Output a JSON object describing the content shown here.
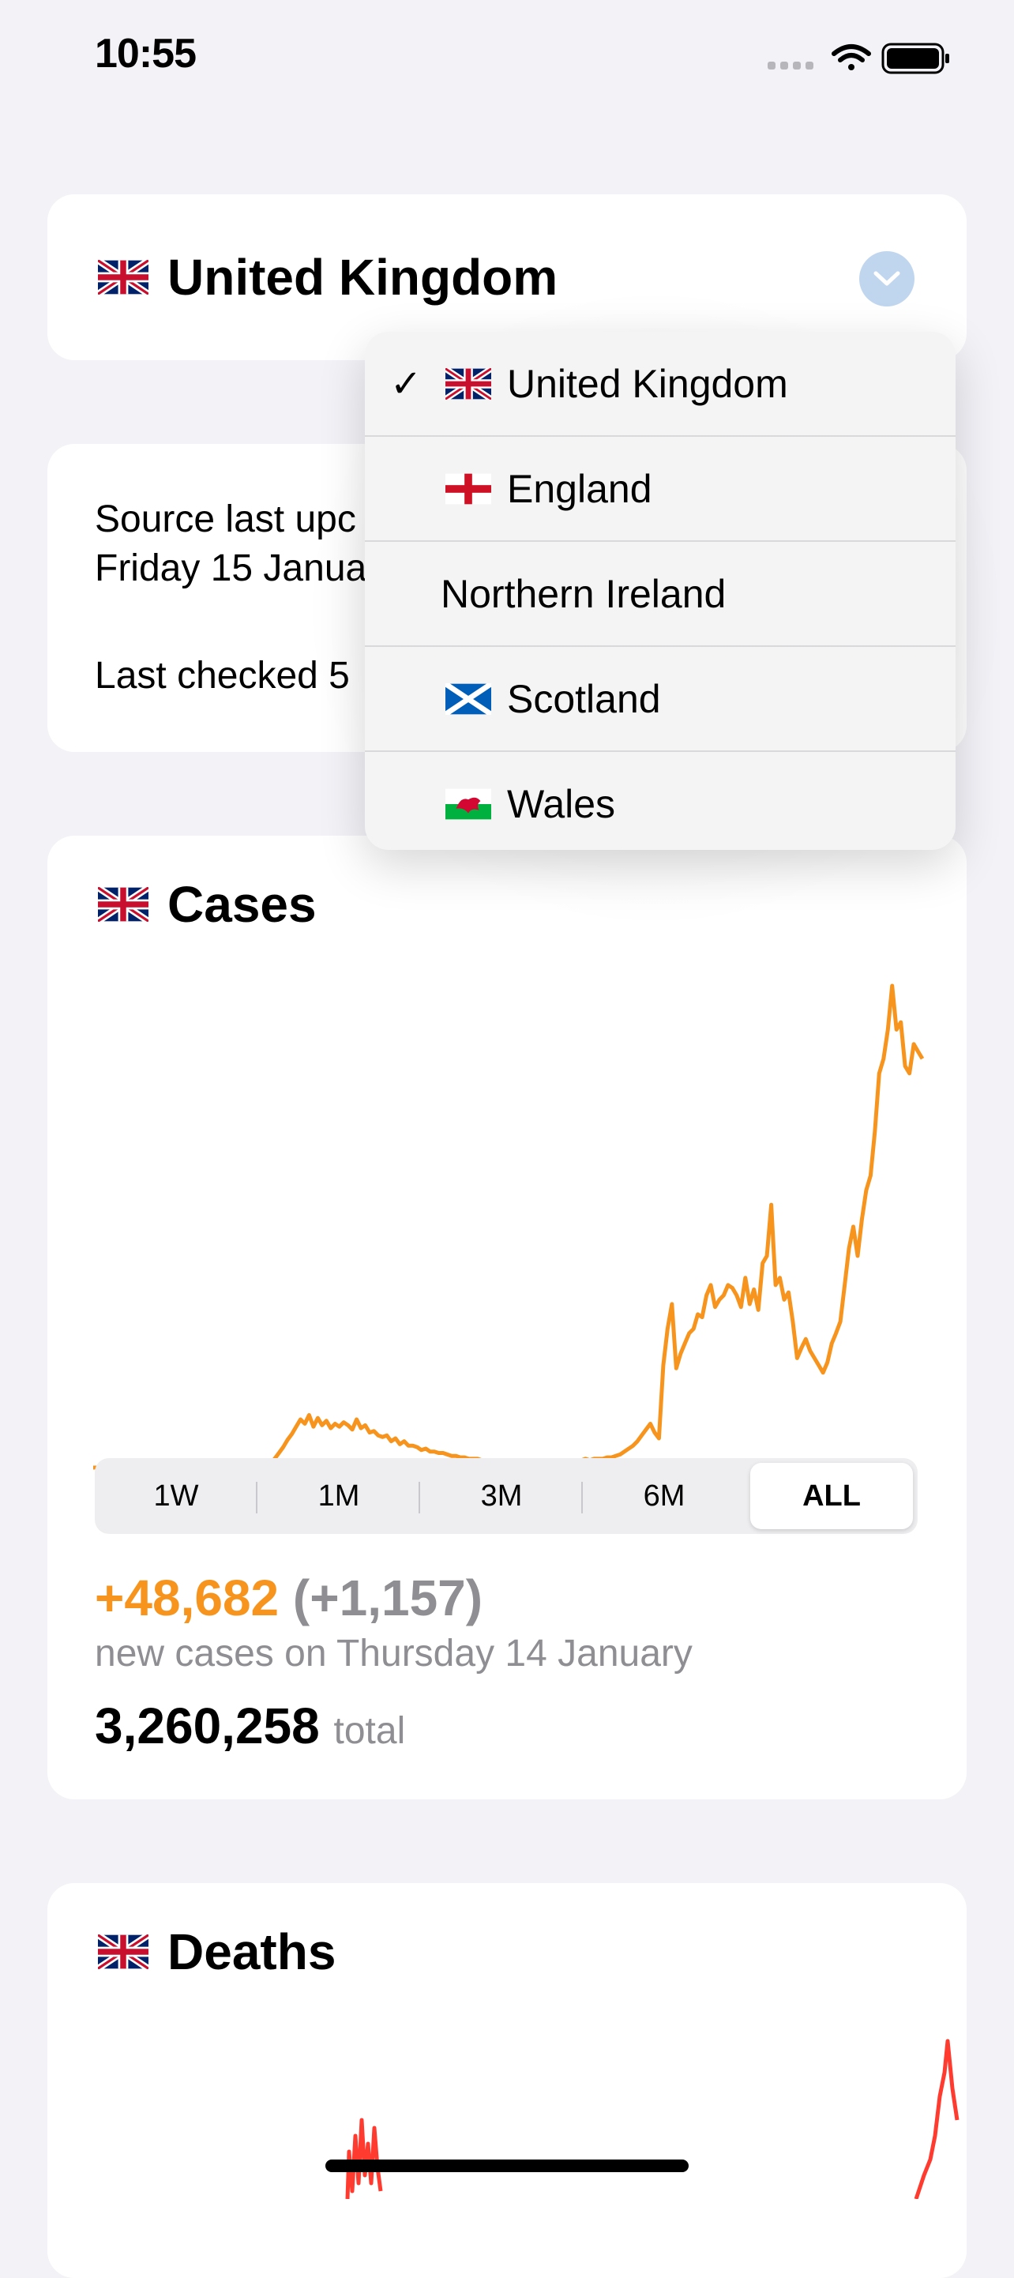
{
  "status_bar": {
    "time": "10:55"
  },
  "country_selector": {
    "flag": "uk-flag",
    "title": "United Kingdom"
  },
  "info": {
    "line1": "Source last upc",
    "line2": "Friday 15 Janua",
    "line3": "Last checked 5"
  },
  "dropdown": {
    "items": [
      {
        "label": "United Kingdom",
        "flag": "uk-flag",
        "checked": true
      },
      {
        "label": "England",
        "flag": "england-flag",
        "checked": false
      },
      {
        "label": "Northern Ireland",
        "flag": "",
        "checked": false
      },
      {
        "label": "Scotland",
        "flag": "scotland-flag",
        "checked": false
      },
      {
        "label": "Wales",
        "flag": "wales-flag",
        "checked": false
      }
    ],
    "check_mark": "✓"
  },
  "cases": {
    "title": "Cases",
    "periods": [
      "1W",
      "1M",
      "3M",
      "6M",
      "ALL"
    ],
    "selected_period": "ALL",
    "new_cases": "+48,682",
    "change": "(+1,157)",
    "new_cases_caption": "new cases on Thursday 14 January",
    "total": "3,260,258",
    "total_label": "total",
    "color": "#f7941d"
  },
  "deaths": {
    "title": "Deaths",
    "color": "#ff3b30"
  },
  "chart_data": {
    "type": "line",
    "series": [
      {
        "values": [
          0,
          0,
          0,
          0,
          0,
          0,
          0,
          0,
          0,
          0,
          0,
          0,
          0,
          0,
          0,
          0,
          0,
          0,
          0,
          0,
          0,
          0,
          0,
          0,
          0,
          0,
          0,
          0,
          0,
          0,
          0,
          0,
          0,
          0,
          0,
          0,
          0,
          0,
          0,
          0,
          1,
          3,
          6,
          10,
          14,
          19,
          23,
          28,
          33,
          30,
          36,
          28,
          34,
          29,
          32,
          27,
          30,
          28,
          31,
          29,
          26,
          33,
          27,
          29,
          24,
          25,
          22,
          21,
          22,
          18,
          20,
          16,
          18,
          15,
          15,
          14,
          12,
          13,
          11,
          11,
          10,
          10,
          9,
          8,
          8,
          7,
          7,
          6,
          6,
          6,
          5,
          5,
          4,
          4,
          4,
          4,
          3,
          3,
          4,
          3,
          3,
          4,
          3,
          4,
          4,
          4,
          4,
          5,
          4,
          4,
          5,
          5,
          5,
          5,
          6,
          5,
          6,
          6,
          6,
          7,
          7,
          8,
          9,
          11,
          13,
          15,
          18,
          22,
          26,
          30,
          24,
          20,
          70,
          95,
          112,
          68,
          78,
          85,
          92,
          95,
          105,
          103,
          118,
          125,
          110,
          115,
          118,
          125,
          123,
          118,
          110,
          130,
          112,
          122,
          108,
          140,
          145,
          180,
          125,
          130,
          115,
          120,
          100,
          75,
          82,
          88,
          80,
          75,
          70,
          65,
          72,
          85,
          92,
          100,
          125,
          150,
          165,
          145,
          170,
          190,
          200,
          230,
          270,
          280,
          300,
          330,
          300,
          305,
          275,
          270,
          290,
          285,
          280
        ]
      }
    ]
  }
}
